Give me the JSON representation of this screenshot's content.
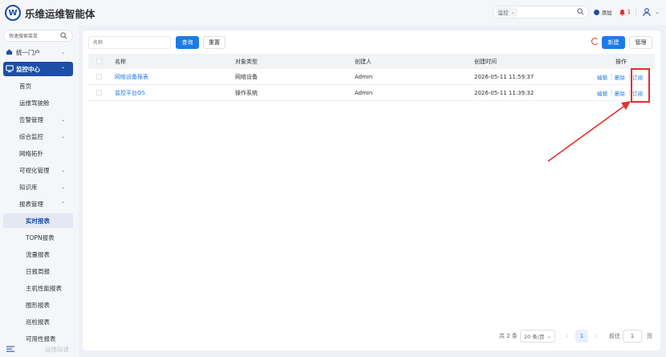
{
  "header": {
    "logo_letter": "W",
    "app_title": "乐维运维智能体",
    "search_scope": "监控",
    "add_label": "添加",
    "alert_count": "1"
  },
  "sidebar": {
    "search_placeholder": "快速搜索菜单",
    "items": [
      {
        "label": "统一门户"
      },
      {
        "label": "监控中心"
      },
      {
        "label": "首页"
      },
      {
        "label": "运维驾驶舱"
      },
      {
        "label": "告警管理"
      },
      {
        "label": "综合监控"
      },
      {
        "label": "网络拓扑"
      },
      {
        "label": "可视化管理"
      },
      {
        "label": "知识库"
      },
      {
        "label": "报表管理"
      },
      {
        "label": "实时报表"
      },
      {
        "label": "TOPN报表"
      },
      {
        "label": "流量报表"
      },
      {
        "label": "日报周报"
      },
      {
        "label": "主机性能报表"
      },
      {
        "label": "图形报表"
      },
      {
        "label": "巡检报表"
      },
      {
        "label": "可用性报表"
      }
    ],
    "bottom_label": "运维知译"
  },
  "toolbar": {
    "name_placeholder": "名称",
    "query_label": "查询",
    "reset_label": "重置",
    "new_label": "新建",
    "manage_label": "管理"
  },
  "table": {
    "headers": {
      "name": "名称",
      "object_type": "对象类型",
      "creator": "创建人",
      "created_at": "创建时间",
      "actions": "操作"
    },
    "rows": [
      {
        "name": "网络设备报表",
        "object_type": "网络设备",
        "creator": "Admin",
        "created_at": "2026-05-11 11:59:37",
        "edit": "编辑",
        "delete": "删除",
        "subscribe": "订阅"
      },
      {
        "name": "监控平台OS",
        "object_type": "操作系统",
        "creator": "Admin",
        "created_at": "2026-05-11 11:39:32",
        "edit": "编辑",
        "delete": "删除",
        "subscribe": "订阅"
      }
    ]
  },
  "pagination": {
    "total": "共 2 条",
    "page_size": "20 条/页",
    "current_page": "1",
    "goto_label": "前往",
    "goto_value": "1",
    "page_unit": "页"
  },
  "colors": {
    "brand": "#1c4fa8",
    "primary": "#1c7be8",
    "alert": "#e0312f"
  }
}
